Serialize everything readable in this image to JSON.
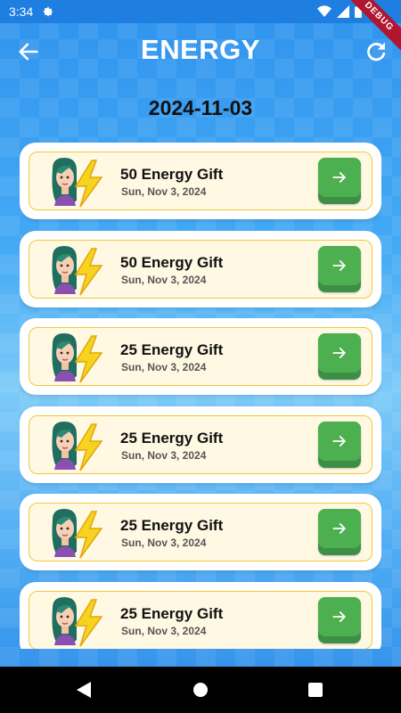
{
  "status_bar": {
    "time": "3:34",
    "debug_label": "DEBUG"
  },
  "app_bar": {
    "title": "ENERGY"
  },
  "date_heading": "2024-11-03",
  "gifts": [
    {
      "title": "50 Energy Gift",
      "date": "Sun, Nov 3, 2024"
    },
    {
      "title": "50 Energy Gift",
      "date": "Sun, Nov 3, 2024"
    },
    {
      "title": "25 Energy Gift",
      "date": "Sun, Nov 3, 2024"
    },
    {
      "title": "25 Energy Gift",
      "date": "Sun, Nov 3, 2024"
    },
    {
      "title": "25 Energy Gift",
      "date": "Sun, Nov 3, 2024"
    },
    {
      "title": "25 Energy Gift",
      "date": "Sun, Nov 3, 2024"
    }
  ],
  "colors": {
    "primary_blue": "#2f93ee",
    "card_bg": "#fff8e3",
    "card_border": "#f2c839",
    "button_green": "#4caf50",
    "debug_red": "#b0162f"
  }
}
